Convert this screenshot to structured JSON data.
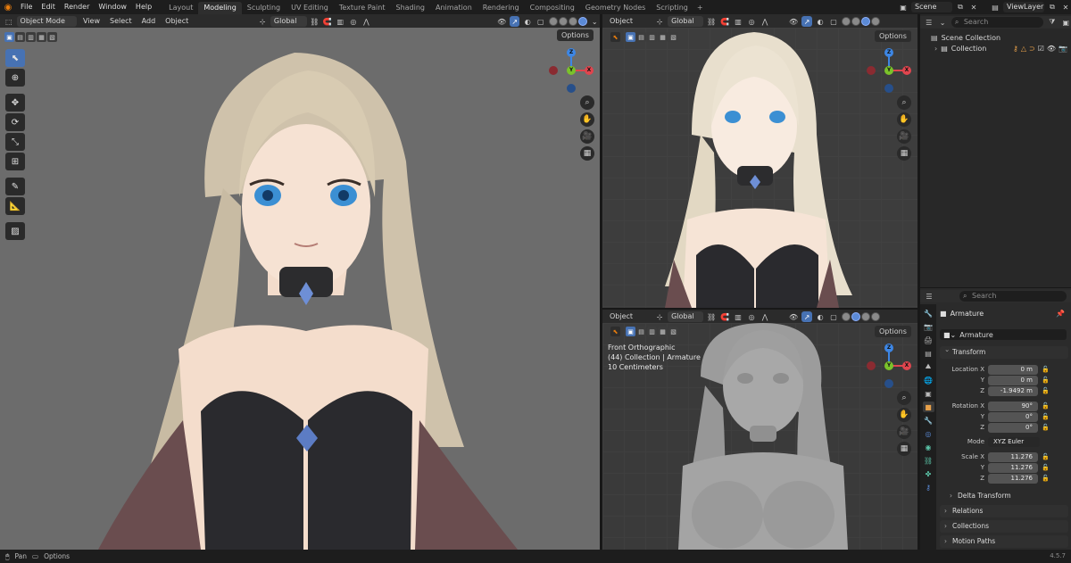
{
  "menu": [
    "File",
    "Edit",
    "Render",
    "Window",
    "Help"
  ],
  "workspaces": [
    {
      "label": "Layout",
      "active": false
    },
    {
      "label": "Modeling",
      "active": true
    },
    {
      "label": "Sculpting",
      "active": false
    },
    {
      "label": "UV Editing",
      "active": false
    },
    {
      "label": "Texture Paint",
      "active": false
    },
    {
      "label": "Shading",
      "active": false
    },
    {
      "label": "Animation",
      "active": false
    },
    {
      "label": "Rendering",
      "active": false
    },
    {
      "label": "Compositing",
      "active": false
    },
    {
      "label": "Geometry Nodes",
      "active": false
    },
    {
      "label": "Scripting",
      "active": false
    }
  ],
  "workspace_add": "+",
  "scene_name": "Scene",
  "view_layer": "ViewLayer",
  "main_view": {
    "mode": "Object Mode",
    "menu": [
      "View",
      "Select",
      "Add",
      "Object"
    ],
    "orientation": "Global",
    "options": "Options"
  },
  "top_right_view": {
    "mode": "Object",
    "orientation": "Global",
    "options": "Options"
  },
  "bottom_right_view": {
    "mode": "Object",
    "orientation": "Global",
    "options": "Options",
    "overlay": [
      "Front Orthographic",
      "(44) Collection | Armature",
      "10 Centimeters"
    ]
  },
  "gizmo_axes": {
    "z": "Z",
    "y": "Y",
    "x": "X"
  },
  "outliner": {
    "search_placeholder": "Search",
    "scene_collection": "Scene Collection",
    "collection": "Collection"
  },
  "properties": {
    "search_placeholder": "Search",
    "object_name": "Armature",
    "data_name": "Armature",
    "transform_header": "Transform",
    "location": {
      "label": "Location X",
      "x": "0 m",
      "y": "0 m",
      "z": "-1.9492 m"
    },
    "rotation": {
      "label": "Rotation X",
      "x": "90°",
      "y": "0°",
      "z": "0°"
    },
    "mode_label": "Mode",
    "mode_value": "XYZ Euler",
    "scale": {
      "label": "Scale X",
      "x": "11.276",
      "y": "11.276",
      "z": "11.276"
    },
    "axis_y": "Y",
    "axis_z": "Z",
    "delta_transform": "Delta Transform",
    "relations": "Relations",
    "collections": "Collections",
    "motion_paths": "Motion Paths"
  },
  "status": {
    "pan": "Pan",
    "options": "Options"
  },
  "version": "4.5.7",
  "colors": {
    "accent": "#4772b3",
    "blender_orange": "#e87d0d",
    "axis_x": "#e0454e",
    "axis_y": "#7bc22a",
    "axis_z": "#3d86e4"
  }
}
